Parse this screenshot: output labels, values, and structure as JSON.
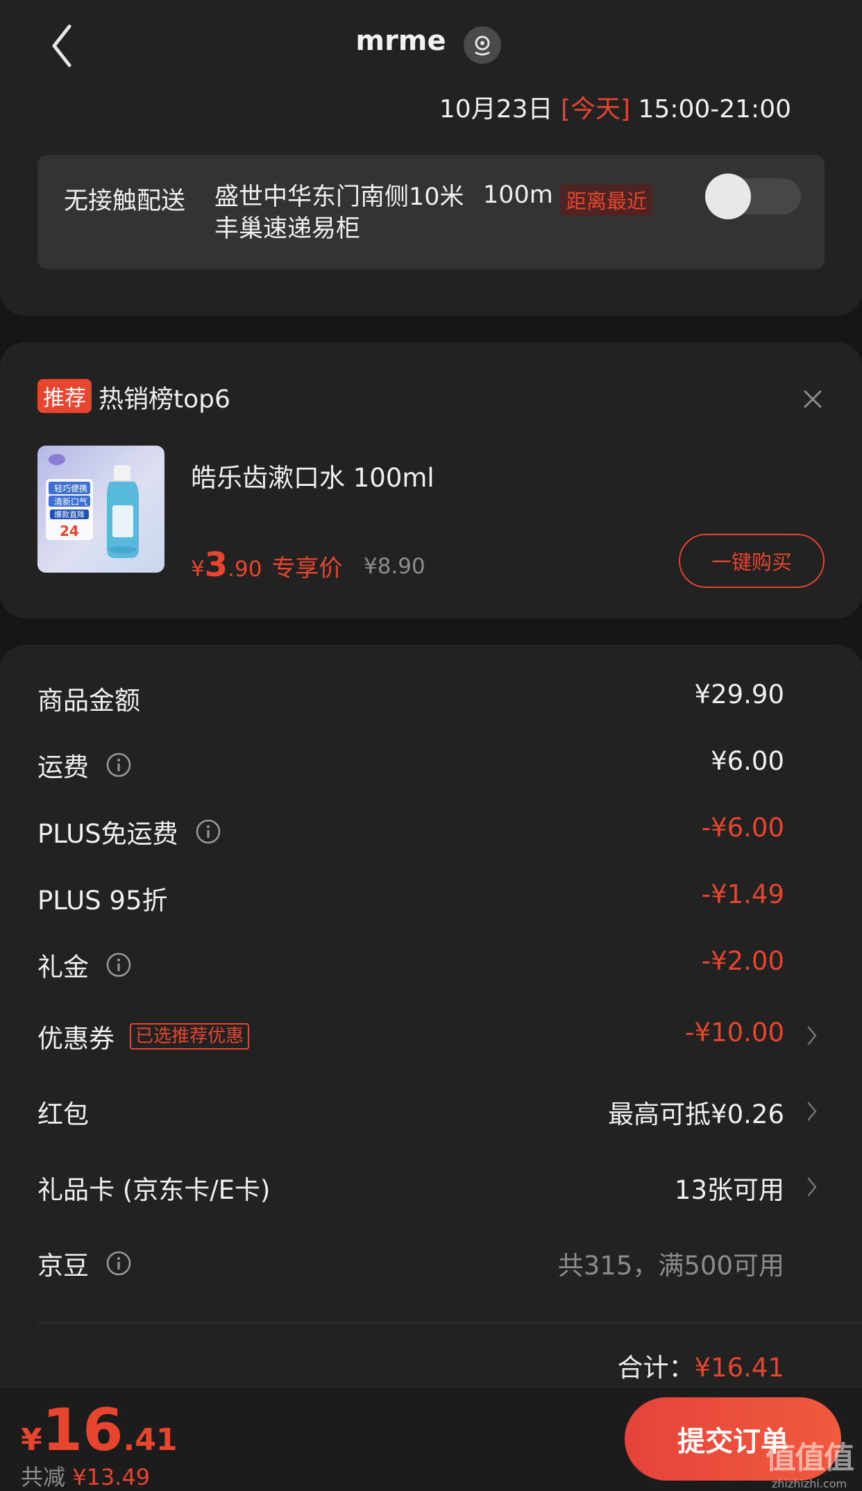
{
  "header": {
    "title": "mrme",
    "delivery_date": "10月23日",
    "delivery_today": "[今天]",
    "delivery_window": "15:00-21:00"
  },
  "delivery_option": {
    "label": "无接触配送",
    "locker_name": "盛世中华东门南侧10米丰巢速递易柜",
    "distance": "100m",
    "nearest_badge": "距离最近",
    "toggle_on": false
  },
  "recommendation": {
    "badge": "推荐",
    "title": "热销榜top6",
    "product": {
      "name": "皓乐齿漱口水 100ml",
      "price_symbol": "¥",
      "price_int": "3",
      "price_dec": ".90",
      "price_tag": "专享价",
      "original_price": "¥8.90",
      "image_text": {
        "line1": "轻巧便携",
        "line2": "清新口气",
        "line3": "爆款直降",
        "price": "24"
      }
    },
    "buy_label": "一键购买"
  },
  "summary": {
    "rows": [
      {
        "label": "商品金额",
        "value": "¥29.90"
      },
      {
        "label": "运费",
        "value": "¥6.00"
      },
      {
        "label": "PLUS免运费",
        "value": "-¥6.00"
      },
      {
        "label": "PLUS 95折",
        "value": "-¥1.49"
      },
      {
        "label": "礼金",
        "value": "-¥2.00"
      },
      {
        "label": "优惠券",
        "tag": "已选推荐优惠",
        "value": "-¥10.00"
      },
      {
        "label": "红包",
        "value": "最高可抵¥0.26"
      },
      {
        "label": "礼品卡 (京东卡/E卡)",
        "value": "13张可用"
      },
      {
        "label": "京豆",
        "value": "共315，满500可用"
      }
    ],
    "total_label": "合计：",
    "total_value": "¥16.41"
  },
  "footer": {
    "price_symbol": "¥",
    "price_int": "16",
    "price_dec": ".41",
    "saved_label": "共减",
    "saved_value": "¥13.49",
    "submit_label": "提交订单"
  },
  "watermark": {
    "logo": "值值值",
    "site": "zhizhizhi.com"
  },
  "colors": {
    "accent": "#e8452f",
    "background": "#161616",
    "card": "#222222"
  }
}
